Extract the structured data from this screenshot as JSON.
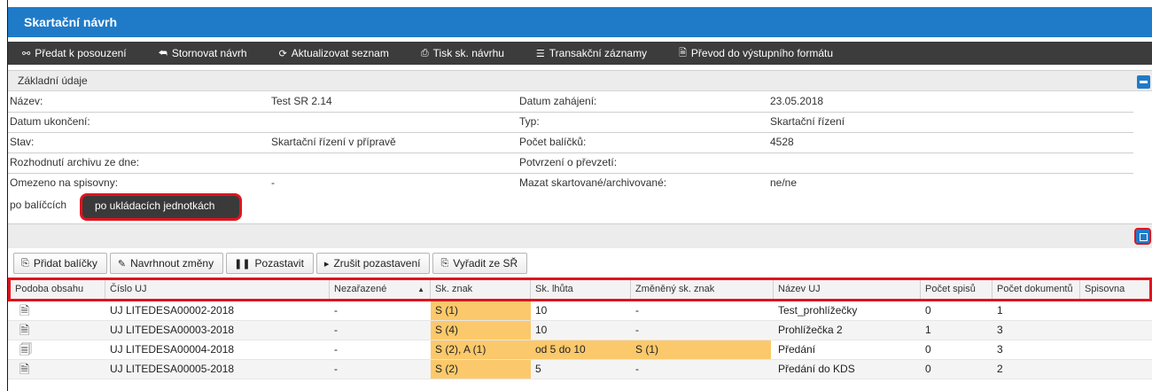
{
  "window": {
    "title": "Skartační návrh"
  },
  "actions": [
    {
      "icon": "link-icon",
      "glyph": "⚯",
      "label": "Předat k posouzení"
    },
    {
      "icon": "undo-arrow-icon",
      "glyph": "⮪",
      "label": "Stornovat návrh"
    },
    {
      "icon": "refresh-icon",
      "glyph": "⟳",
      "label": "Aktualizovat seznam"
    },
    {
      "icon": "print-icon",
      "glyph": "⎙",
      "label": "Tisk sk. návrhu"
    },
    {
      "icon": "list-icon",
      "glyph": "☰",
      "label": "Transakční záznamy"
    },
    {
      "icon": "document-icon",
      "glyph": "🗎",
      "label": "Převod do výstupního formátu"
    }
  ],
  "basic": {
    "section_title": "Základní údaje",
    "rows": [
      {
        "l1": "Název:",
        "v1": "Test SR 2.14",
        "l2": "Datum zahájení:",
        "v2": "23.05.2018"
      },
      {
        "l1": "Datum ukončení:",
        "v1": "",
        "l2": "Typ:",
        "v2": "Skartační řízení"
      },
      {
        "l1": "Stav:",
        "v1": "Skartační řízení v přípravě",
        "l2": "Počet balíčků:",
        "v2": "4528"
      },
      {
        "l1": "Rozhodnutí archivu ze dne:",
        "v1": "",
        "l2": "Potvrzení o převzetí:",
        "v2": ""
      },
      {
        "l1": "Omezeno na spisovny:",
        "v1": "-",
        "l2": "Mazat skartované/archivované:",
        "v2": "ne/ne"
      }
    ]
  },
  "view_tabs": {
    "by_packages": "po balíčcích",
    "by_units": "po ukládacích jednotkách"
  },
  "toolbar": [
    {
      "icon": "add-doc-icon",
      "glyph": "⎘",
      "label": "Přidat balíčky"
    },
    {
      "icon": "edit-icon",
      "glyph": "✎",
      "label": "Navrhnout změny"
    },
    {
      "icon": "pause-icon",
      "glyph": "❚❚",
      "label": "Pozastavit"
    },
    {
      "icon": "play-icon",
      "glyph": "▸",
      "label": "Zrušit pozastavení"
    },
    {
      "icon": "remove-doc-icon",
      "glyph": "⎘",
      "label": "Vyřadit ze SŘ"
    }
  ],
  "grid": {
    "sort_indicator": "▲",
    "columns": [
      "Podoba obsahu",
      "Číslo UJ",
      "Nezařazené",
      "Sk. znak",
      "Sk. lhůta",
      "Změněný sk. znak",
      "Název UJ",
      "Počet spisů",
      "Počet dokumentů",
      "Spisovna"
    ],
    "rows": [
      {
        "icon": "🗎",
        "cislo": "UJ LITEDESA00002-2018",
        "nezar": "-",
        "znak": "S (1)",
        "lhuta": "10",
        "zmeneny": "-",
        "nazev": "Test_prohlížečky",
        "spisy": "0",
        "dokumenty": "1",
        "spisovna": ""
      },
      {
        "icon": "🗎",
        "cislo": "UJ LITEDESA00003-2018",
        "nezar": "-",
        "znak": "S (4)",
        "lhuta": "10",
        "zmeneny": "-",
        "nazev": "Prohlížečka 2",
        "spisy": "1",
        "dokumenty": "3",
        "spisovna": ""
      },
      {
        "icon": "🗐",
        "cislo": "UJ LITEDESA00004-2018",
        "nezar": "-",
        "znak": "S (2), A (1)",
        "lhuta": "od 5 do 10",
        "zmeneny": "S (1)",
        "nazev": "Předání",
        "spisy": "0",
        "dokumenty": "3",
        "spisovna": ""
      },
      {
        "icon": "🗎",
        "cislo": "UJ LITEDESA00005-2018",
        "nezar": "-",
        "znak": "S (2)",
        "lhuta": "5",
        "zmeneny": "-",
        "nazev": "Předání do KDS",
        "spisy": "0",
        "dokumenty": "2",
        "spisovna": ""
      }
    ]
  }
}
